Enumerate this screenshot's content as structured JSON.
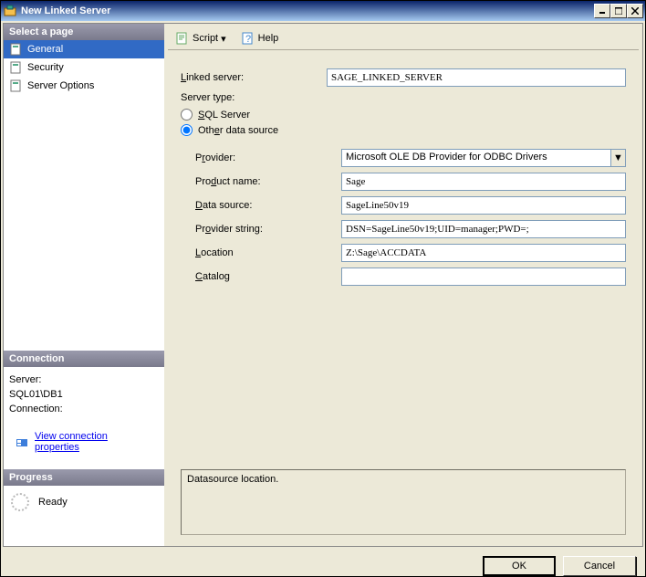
{
  "titlebar": {
    "text": "New Linked Server"
  },
  "sidebar": {
    "select_page": "Select a page",
    "items": [
      "General",
      "Security",
      "Server Options"
    ]
  },
  "toolbar": {
    "script": "Script",
    "help": "Help"
  },
  "form": {
    "linked_server_label": "Linked server:",
    "linked_server_value": "SAGE_LINKED_SERVER",
    "server_type_label": "Server type:",
    "sql_server_label": "SQL Server",
    "other_label": "Other data source",
    "provider_label": "Provider:",
    "provider_value": "Microsoft OLE DB Provider for ODBC Drivers",
    "product_name_label": "Product name:",
    "product_name_value": "Sage",
    "data_source_label": "Data source:",
    "data_source_value": "SageLine50v19",
    "provider_string_label": "Provider string:",
    "provider_string_value": "DSN=SageLine50v19;UID=manager;PWD=;",
    "location_label": "Location",
    "location_value": "Z:\\Sage\\ACCDATA",
    "catalog_label": "Catalog",
    "catalog_value": "",
    "desc": "Datasource location."
  },
  "connection": {
    "header": "Connection",
    "server_label": "Server:",
    "server_value": "SQL01\\DB1",
    "connection_label": "Connection:",
    "connection_value": "",
    "view_props": "View connection properties"
  },
  "progress": {
    "header": "Progress",
    "status": "Ready"
  },
  "footer": {
    "ok": "OK",
    "cancel": "Cancel"
  }
}
